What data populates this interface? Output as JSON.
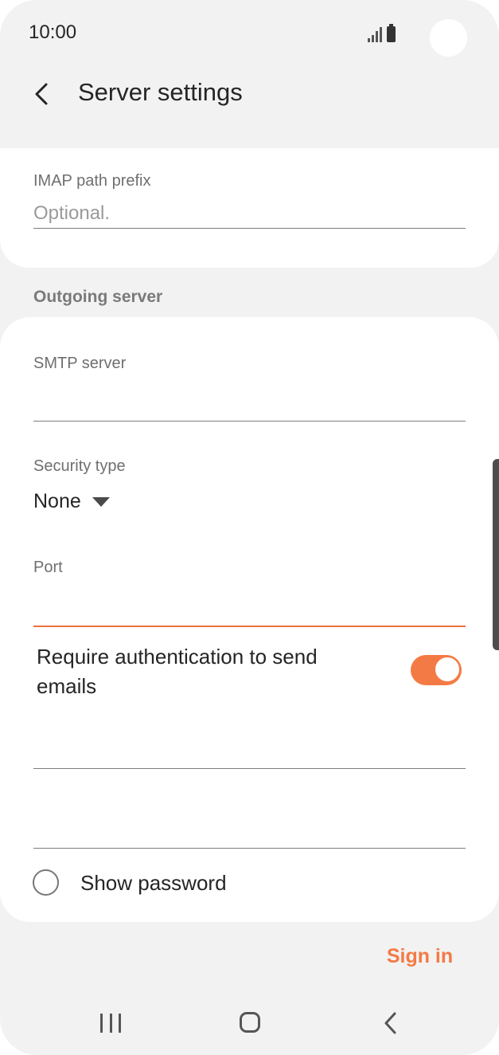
{
  "status_bar": {
    "time": "10:00"
  },
  "header": {
    "title": "Server settings"
  },
  "imap": {
    "label": "IMAP path prefix",
    "placeholder": "Optional.",
    "value": ""
  },
  "outgoing": {
    "section_title": "Outgoing server",
    "smtp_label": "SMTP server",
    "smtp_value": "",
    "security_label": "Security type",
    "security_value": "None",
    "port_label": "Port",
    "port_value": "",
    "auth_label": "Require authentication to send emails",
    "auth_enabled": true,
    "username_value": "",
    "password_value": "",
    "show_password_label": "Show password"
  },
  "actions": {
    "sign_in_label": "Sign in"
  },
  "colors": {
    "accent": "#f47a45",
    "background": "#f2f2f2",
    "card": "#ffffff",
    "text": "#252525"
  }
}
